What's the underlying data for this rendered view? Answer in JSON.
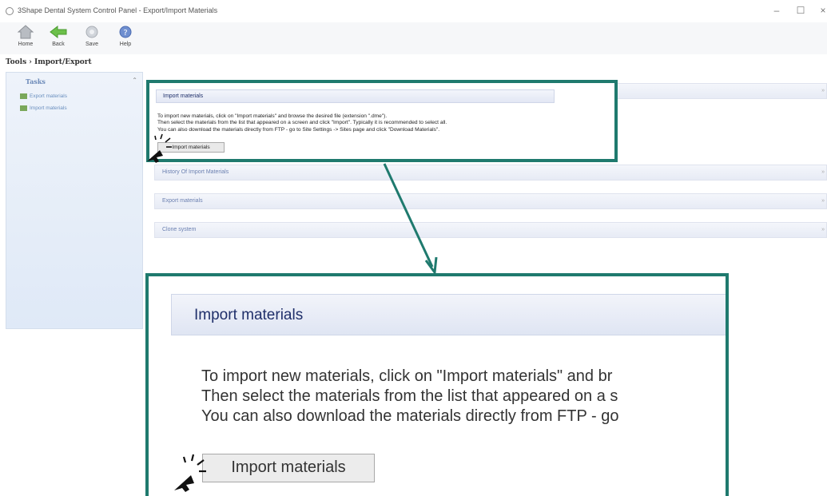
{
  "window": {
    "title": "3Shape Dental System Control Panel - Export/Import Materials",
    "minimize": "–",
    "maximize": "☐",
    "close": "×"
  },
  "toolbar": {
    "home": "Home",
    "back": "Back",
    "save": "Save",
    "help": "Help"
  },
  "breadcrumb": "Tools › Import/Export",
  "sidebar": {
    "heading": "Tasks",
    "collapse": "⌃",
    "items": [
      {
        "label": "Export materials"
      },
      {
        "label": "Import materials"
      }
    ]
  },
  "sections": {
    "import": "Import materials",
    "history": "History Of Import Materials",
    "export": "Export materials",
    "clone": "Clone system",
    "chevron": "»"
  },
  "import_panel": {
    "line1": "To import new materials, click on \"Import materials\" and browse the desired file (extension \".dme\").",
    "line2": "Then select the materials from the list that appeared on a screen and click \"Import\". Typically it is recommended to select all.",
    "line3": "You can also download the materials directly from FTP - go to Site Settings -> Sites page and click \"Download Materials\".",
    "button": "Import materials"
  },
  "zoom": {
    "header": "Import materials",
    "line1": "To import new materials, click on \"Import materials\" and br",
    "line2": "Then select the materials from the list that appeared on a s",
    "line3": "You can also download the materials directly from FTP - go",
    "button": "Import materials"
  },
  "colors": {
    "callout_border": "#1f7a6e",
    "header_text": "#1f2f6a",
    "sidebar_link": "#6a8fbf"
  }
}
